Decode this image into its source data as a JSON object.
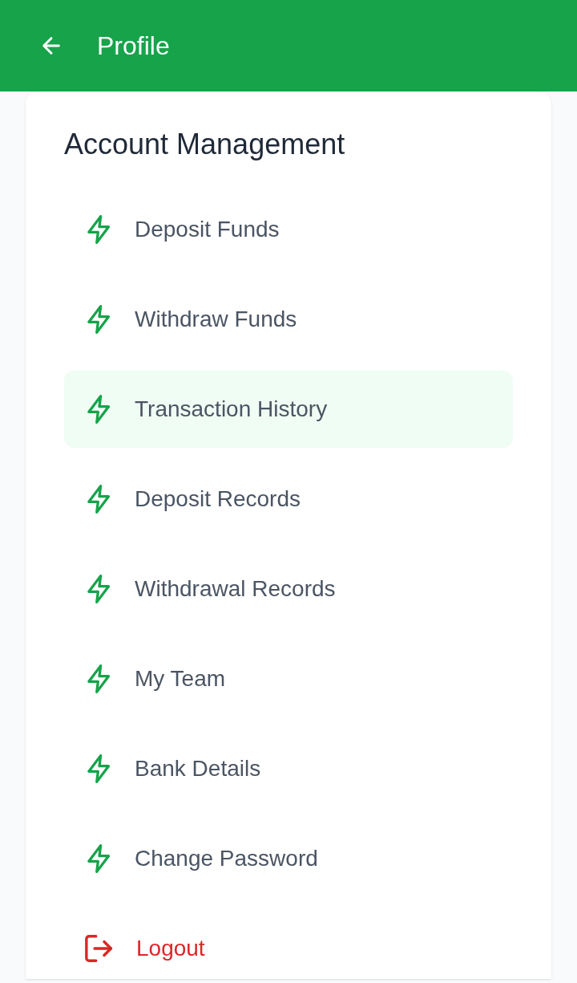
{
  "header": {
    "title": "Profile"
  },
  "section": {
    "title": "Account Management",
    "items": [
      {
        "label": "Deposit Funds",
        "kind": "link",
        "selected": false
      },
      {
        "label": "Withdraw Funds",
        "kind": "link",
        "selected": false
      },
      {
        "label": "Transaction History",
        "kind": "link",
        "selected": true
      },
      {
        "label": "Deposit Records",
        "kind": "link",
        "selected": false
      },
      {
        "label": "Withdrawal Records",
        "kind": "link",
        "selected": false
      },
      {
        "label": "My Team",
        "kind": "link",
        "selected": false
      },
      {
        "label": "Bank Details",
        "kind": "link",
        "selected": false
      },
      {
        "label": "Change Password",
        "kind": "link",
        "selected": false
      },
      {
        "label": "Logout",
        "kind": "logout",
        "selected": false
      }
    ]
  }
}
